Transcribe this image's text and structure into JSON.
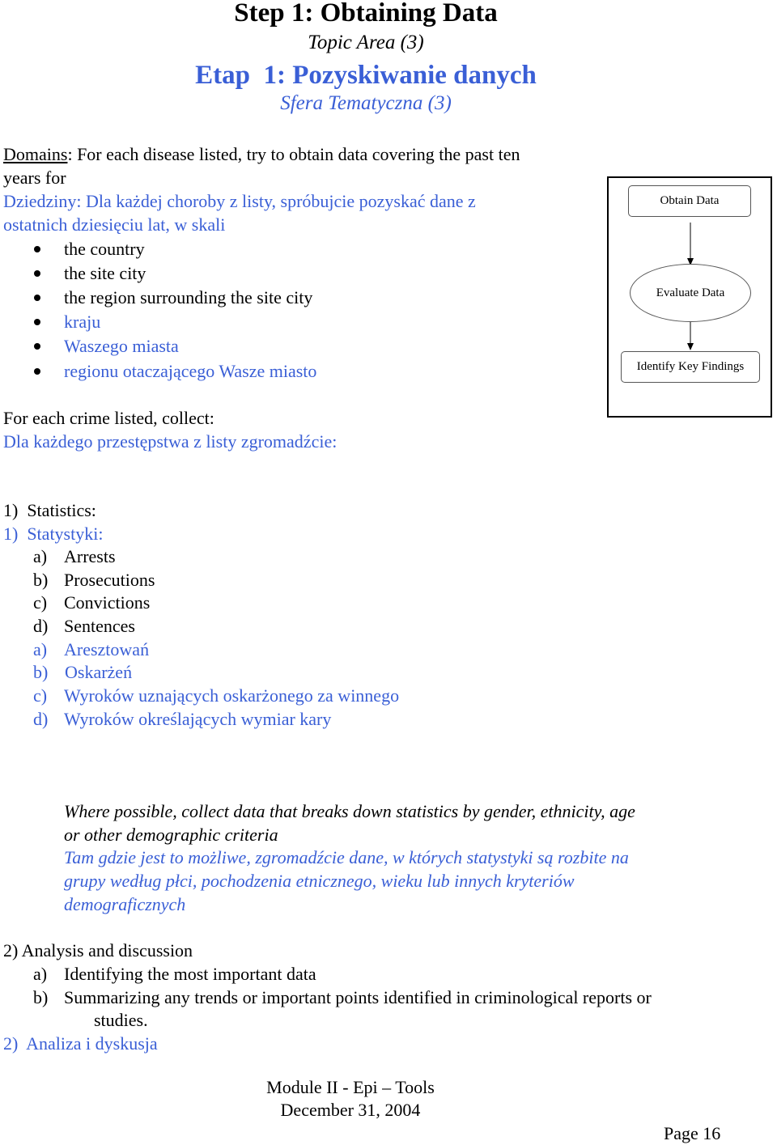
{
  "header": {
    "title_en": "Step 1: Obtaining Data",
    "subtitle_en": "Topic Area (3)",
    "title_pl": "Etap  1: Pozyskiwanie danych",
    "subtitle_pl": "Sfera Tematyczna (3)"
  },
  "domains": {
    "label": "Domains",
    "intro_en_line1": ": For each disease listed, try to obtain data covering the past ten",
    "intro_en_line2": "years for",
    "intro_pl_line1": "Dziedziny: Dla każdej choroby z listy, spróbujcie pozyskać dane z",
    "intro_pl_line2": "ostatnich dziesięciu lat, w skali",
    "bullets_en": [
      "the country",
      "the site city",
      "the region surrounding the site city"
    ],
    "bullets_pl": [
      "kraju",
      "Waszego miasta",
      "regionu otaczającego Wasze miasto"
    ]
  },
  "crime": {
    "intro_en": "For each crime listed, collect:",
    "intro_pl": "Dla każdego przestępstwa z listy zgromadźcie:"
  },
  "statistics": {
    "heading_en": "1)  Statistics:",
    "heading_pl": "1)  Statystyki:",
    "items_en": [
      {
        "marker": "a)",
        "text": "Arrests"
      },
      {
        "marker": "b)",
        "text": "Prosecutions"
      },
      {
        "marker": "c)",
        "text": "Convictions"
      },
      {
        "marker": "d)",
        "text": "Sentences"
      }
    ],
    "items_pl": [
      {
        "marker": "a)",
        "text": "Aresztowań"
      },
      {
        "marker": "b)",
        "text": "Oskarżeń"
      },
      {
        "marker": "c)",
        "text": "Wyroków uznających oskarżonego za winnego"
      },
      {
        "marker": "d)",
        "text": "Wyroków określających wymiar kary"
      }
    ]
  },
  "note": {
    "en_line1": "Where possible, collect data that breaks down statistics by gender, ethnicity, age",
    "en_line2": "or other demographic criteria",
    "pl_line1": "Tam gdzie jest to możliwe, zgromadźcie dane, w których statystyki są rozbite na",
    "pl_line2": "grupy według płci, pochodzenia etnicznego, wieku lub innych kryteriów",
    "pl_line3": "demograficznych"
  },
  "analysis": {
    "heading_en": "2) Analysis and discussion",
    "items_en": [
      {
        "marker": "a)",
        "text": "Identifying the most important data"
      },
      {
        "marker": "b)",
        "text": "Summarizing any trends or important points identified in criminological reports or"
      }
    ],
    "item_b_continuation": "studies.",
    "heading_pl": "2)  Analiza i dyskusja"
  },
  "diagram": {
    "nodes": [
      "Obtain Data",
      "Evaluate Data",
      "Identify Key Findings"
    ]
  },
  "footer": {
    "module": "Module II - Epi – Tools",
    "date": "December 31, 2004",
    "page": "Page 16"
  },
  "colors": {
    "polish_text": "#3a5fd6",
    "english_text": "#000000"
  }
}
